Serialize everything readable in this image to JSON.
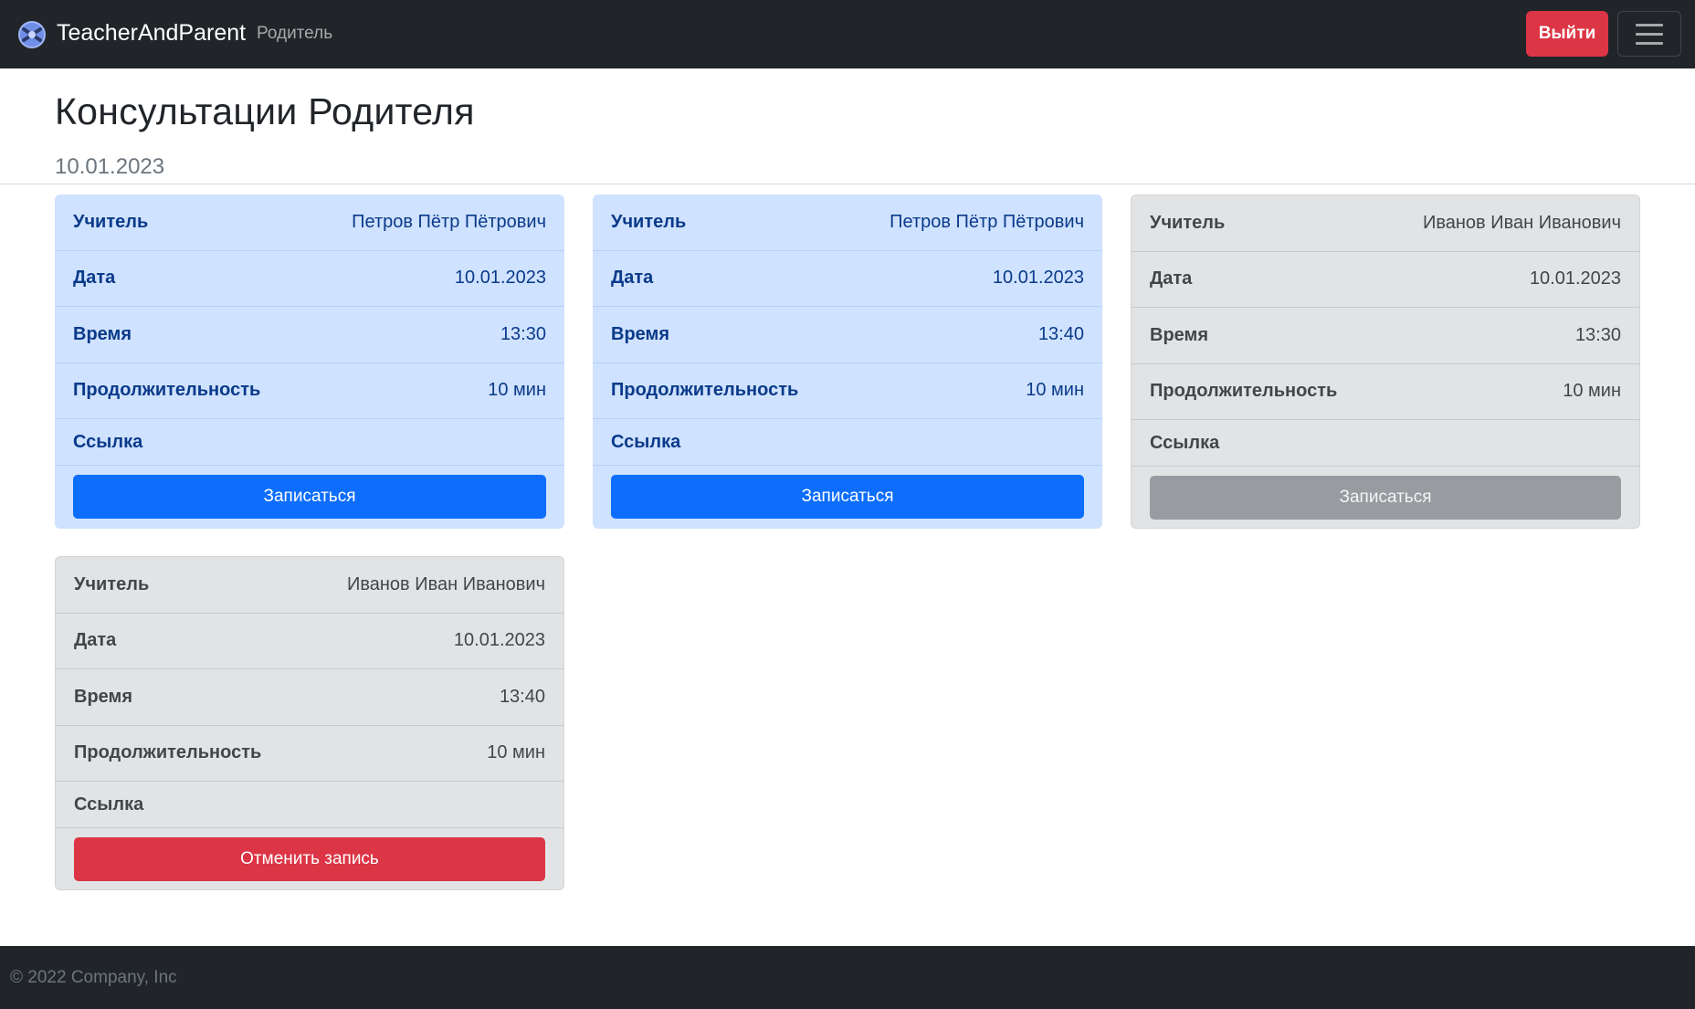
{
  "navbar": {
    "brand_name": "TeacherAndParent",
    "role": "Родитель",
    "logout_label": "Выйти",
    "logo_icon": "brand-logo-icon",
    "menu_icon": "hamburger-icon"
  },
  "header": {
    "title": "Консультации Родителя",
    "date": "10.01.2023"
  },
  "labels": {
    "teacher": "Учитель",
    "date": "Дата",
    "time": "Время",
    "duration": "Продолжительность",
    "link": "Ссылка"
  },
  "cards": [
    {
      "style": "primary",
      "teacher": "Петров Пётр Пётрович",
      "date": "10.01.2023",
      "time": "13:30",
      "duration": "10 мин",
      "link": "",
      "action_label": "Записаться",
      "action_style": "blue"
    },
    {
      "style": "primary",
      "teacher": "Петров Пётр Пётрович",
      "date": "10.01.2023",
      "time": "13:40",
      "duration": "10 мин",
      "link": "",
      "action_label": "Записаться",
      "action_style": "blue"
    },
    {
      "style": "secondary",
      "teacher": "Иванов Иван Иванович",
      "date": "10.01.2023",
      "time": "13:30",
      "duration": "10 мин",
      "link": "",
      "action_label": "Записаться",
      "action_style": "gray"
    },
    {
      "style": "secondary",
      "teacher": "Иванов Иван Иванович",
      "date": "10.01.2023",
      "time": "13:40",
      "duration": "10 мин",
      "link": "",
      "action_label": "Отменить запись",
      "action_style": "red"
    }
  ],
  "footer": {
    "text": "© 2022 Company, Inc"
  },
  "colors": {
    "navbar_bg": "#212529",
    "primary_card": "#cfe2ff",
    "secondary_card": "#e2e3e5",
    "btn_blue": "#0d6efd",
    "btn_red": "#dc3545",
    "btn_gray": "#989ba0"
  }
}
